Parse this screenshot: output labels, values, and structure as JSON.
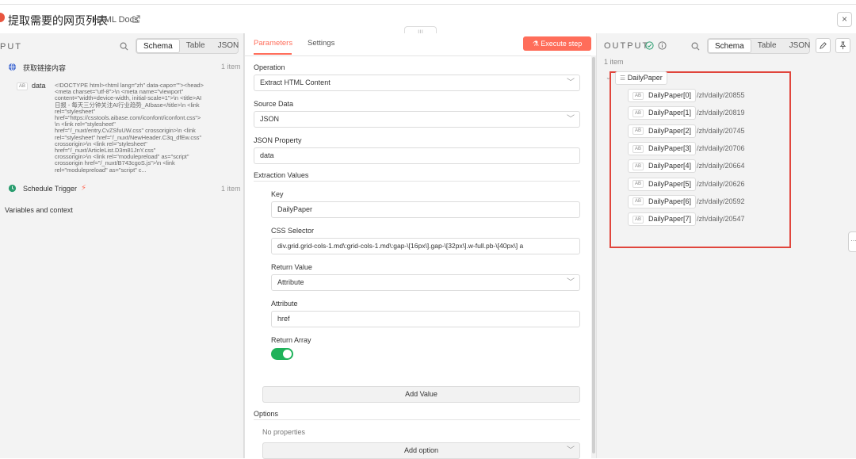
{
  "header": {
    "title": "提取需要的网页列表",
    "docs_label": "HTML Docs",
    "center_handle": "|||",
    "close_glyph": "×"
  },
  "input_panel": {
    "heading": "PUT",
    "tabs": [
      "Schema",
      "Table",
      "JSON"
    ],
    "active_tab": "Schema",
    "node1": {
      "name": "获取链接内容",
      "count": "1 item"
    },
    "data_field": {
      "type": "AB",
      "name": "data",
      "lines": [
        "<!DOCTYPE html><html lang=\"zh\" data-capo=\"\"><head>",
        "<meta charset=\"utf-8\">\\n <meta name=\"viewport\"",
        "content=\"width=device-width, initial-scale=1\">\\n <title>AI",
        "日报 - 每天三分钟关注AI行业趋势_AIbase</title>\\n <link",
        "rel=\"stylesheet\"",
        "href=\"https://csstools.aibase.com/iconfont/iconfont.css\">",
        "\\n <link rel=\"stylesheet\"",
        "href=\"/_nuxt/entry.CvZSfuUW.css\" crossorigin>\\n <link",
        "rel=\"stylesheet\" href=\"/_nuxt/NewHeader.C3q_dfEw.css\"",
        "crossorigin>\\n <link rel=\"stylesheet\"",
        "href=\"/_nuxt/ArticleList.D3m81JnY.css\"",
        "crossorigin>\\n <link rel=\"modulepreload\" as=\"script\"",
        "crossorigin href=\"/_nuxt/B743cgoS.js\">\\n <link",
        "rel=\"modulepreload\" as=\"script\" c..."
      ]
    },
    "node2": {
      "name": "Schedule Trigger",
      "count": "1 item"
    },
    "variables": "Variables and context"
  },
  "params_panel": {
    "tabs": [
      "Parameters",
      "Settings"
    ],
    "active_tab": "Parameters",
    "execute_label": "Execute step",
    "operation": {
      "label": "Operation",
      "value": "Extract HTML Content"
    },
    "source_data": {
      "label": "Source Data",
      "value": "JSON"
    },
    "json_property": {
      "label": "JSON Property",
      "value": "data"
    },
    "extraction_heading": "Extraction Values",
    "key": {
      "label": "Key",
      "value": "DailyPaper"
    },
    "css_selector": {
      "label": "CSS Selector",
      "value": "div.grid.grid-cols-1.md\\:grid-cols-1.md\\:gap-\\[16px\\].gap-\\[32px\\].w-full.pb-\\[40px\\]  a"
    },
    "return_value": {
      "label": "Return Value",
      "value": "Attribute"
    },
    "attribute": {
      "label": "Attribute",
      "value": "href"
    },
    "return_array": {
      "label": "Return Array",
      "enabled": true
    },
    "add_value": "Add Value",
    "options_heading": "Options",
    "no_properties": "No properties",
    "add_option": "Add option"
  },
  "output_panel": {
    "heading": "OUTPUT",
    "tabs": [
      "Schema",
      "Table",
      "JSON"
    ],
    "active_tab": "Schema",
    "count": "1 item",
    "root": "DailyPaper",
    "items": [
      {
        "key": "DailyPaper[0]",
        "value": "/zh/daily/20855"
      },
      {
        "key": "DailyPaper[1]",
        "value": "/zh/daily/20819"
      },
      {
        "key": "DailyPaper[2]",
        "value": "/zh/daily/20745"
      },
      {
        "key": "DailyPaper[3]",
        "value": "/zh/daily/20706"
      },
      {
        "key": "DailyPaper[4]",
        "value": "/zh/daily/20664"
      },
      {
        "key": "DailyPaper[5]",
        "value": "/zh/daily/20626"
      },
      {
        "key": "DailyPaper[6]",
        "value": "/zh/daily/20592"
      },
      {
        "key": "DailyPaper[7]",
        "value": "/zh/daily/20547"
      }
    ]
  },
  "colors": {
    "accent": "#ff6d5a",
    "toggle": "#1fb25a",
    "highlight_box": "#e0453c"
  }
}
